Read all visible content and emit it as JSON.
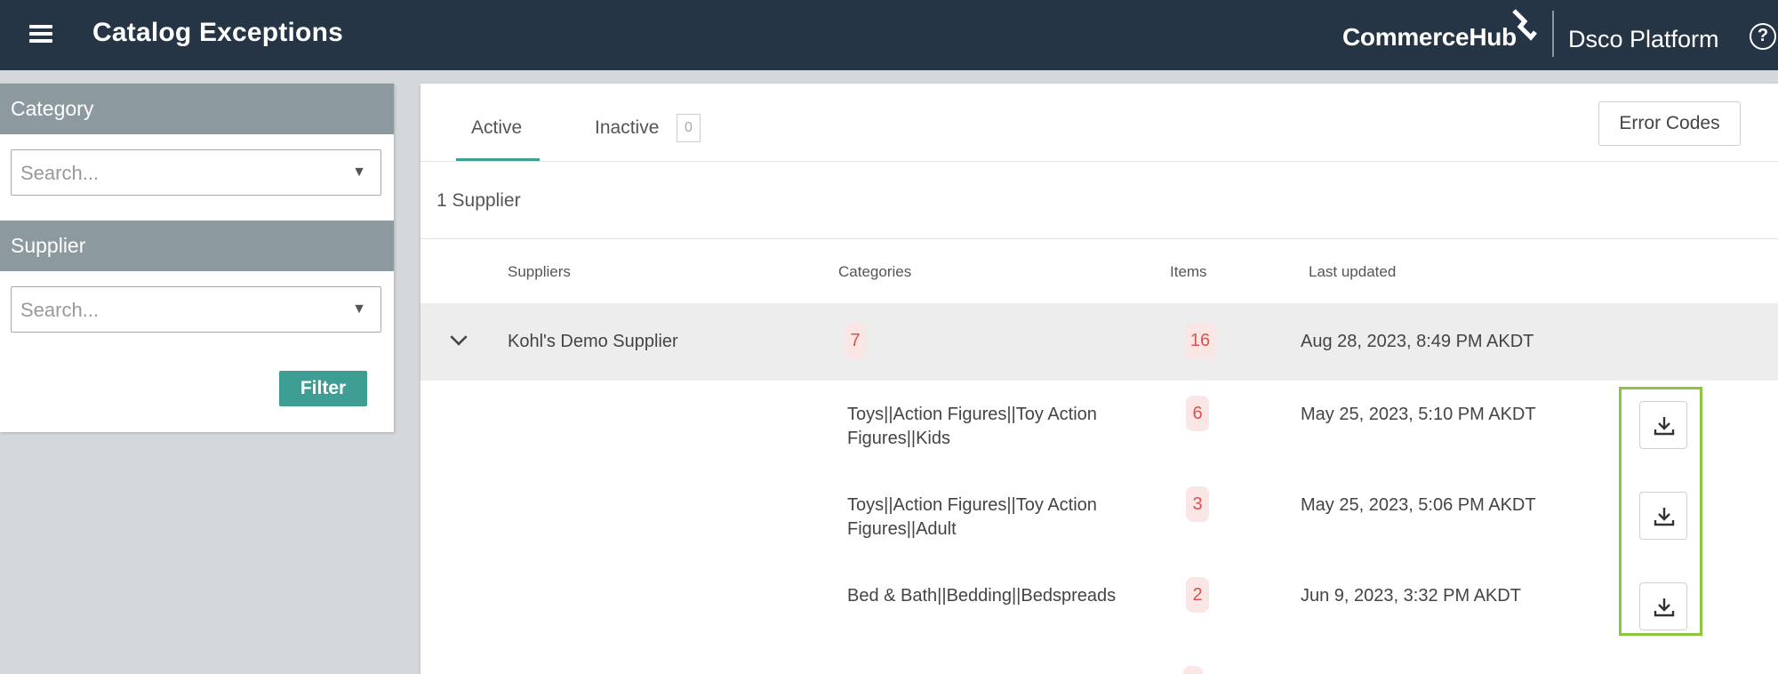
{
  "header": {
    "title": "Catalog Exceptions",
    "brand": "CommerceHub",
    "platform": "Dsco Platform",
    "help": "?"
  },
  "filters": {
    "category": {
      "label": "Category",
      "placeholder": "Search..."
    },
    "supplier": {
      "label": "Supplier",
      "placeholder": "Search..."
    },
    "filter_button": "Filter"
  },
  "tabs": {
    "active": "Active",
    "inactive": "Inactive",
    "inactive_count": "0"
  },
  "error_codes_button": "Error Codes",
  "supplier_count": "1 Supplier",
  "table": {
    "headers": {
      "suppliers": "Suppliers",
      "categories": "Categories",
      "items": "Items",
      "last_updated": "Last updated"
    },
    "supplier": {
      "name": "Kohl's Demo Supplier",
      "categories": "7",
      "items": "16",
      "last_updated": "Aug 28, 2023, 8:49 PM AKDT"
    },
    "category_rows": [
      {
        "category": "Toys||Action Figures||Toy Action Figures||Kids",
        "items": "6",
        "last_updated": "May 25, 2023, 5:10 PM AKDT"
      },
      {
        "category": "Toys||Action Figures||Toy Action Figures||Adult",
        "items": "3",
        "last_updated": "May 25, 2023, 5:06 PM AKDT"
      },
      {
        "category": "Bed & Bath||Bedding||Bedspreads",
        "items": "2",
        "last_updated": "Jun 9, 2023, 3:32 PM AKDT"
      }
    ]
  },
  "colors": {
    "topbar": "#263545",
    "accent": "#3e9e93",
    "badge_bg": "#fbe6e6",
    "badge_text": "#d9534f",
    "highlight": "#8cc63f"
  }
}
